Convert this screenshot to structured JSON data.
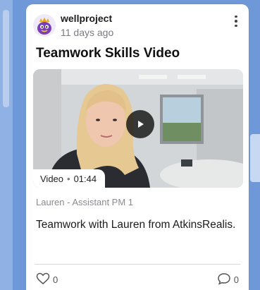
{
  "post": {
    "author": "wellproject",
    "time": "11 days ago",
    "title": "Teamwork Skills Video",
    "video": {
      "type_label": "Video",
      "separator": "•",
      "duration": "01:44"
    },
    "caption": "Lauren - Assistant PM 1",
    "body": "Teamwork with Lauren from AtkinsRealis.",
    "likes": "0",
    "comments": "0"
  },
  "icons": {
    "avatar": "monster-avatar-icon",
    "more": "kebab-menu-icon",
    "play": "play-icon",
    "like": "heart-icon",
    "comment": "comment-bubble-icon"
  },
  "colors": {
    "board_background": "#6f98d8",
    "card_background": "#ffffff"
  }
}
